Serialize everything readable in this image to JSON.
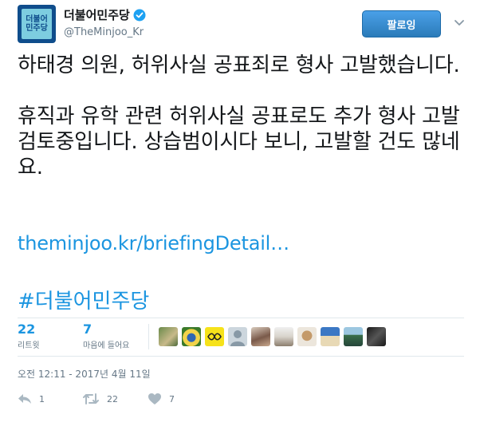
{
  "account": {
    "display_name": "더불어민주당",
    "handle": "@TheMinjoo_Kr",
    "avatar_text": "더불어\n민주당"
  },
  "header": {
    "follow_label": "팔로잉"
  },
  "tweet": {
    "paragraph_1": "하태경 의원, 허위사실 공표죄로 형사 고발했습니다.",
    "paragraph_2": "휴직과 유학 관련 허위사실 공표로도 추가 형사 고발 검토중입니다. 상습범이시다 보니, 고발할 건도 많네요.",
    "link": "theminjoo.kr/briefingDetail…",
    "hashtag": "#더불어민주당"
  },
  "stats": {
    "retweets": {
      "count": "22",
      "label": "리트윗"
    },
    "likes": {
      "count": "7",
      "label": "마음에 들어요"
    }
  },
  "timestamp": "오전 12:11 - 2017년 4월 11일",
  "actions": {
    "reply_count": "1",
    "retweet_count": "22",
    "like_count": "7"
  },
  "colors": {
    "accent": "#1b95e0",
    "follow_button": "#2b7bb9",
    "muted": "#657786",
    "divider": "#e1e8ed"
  },
  "icons": [
    "verified-badge-icon",
    "chevron-down-icon",
    "reply-icon",
    "retweet-icon",
    "heart-icon"
  ]
}
